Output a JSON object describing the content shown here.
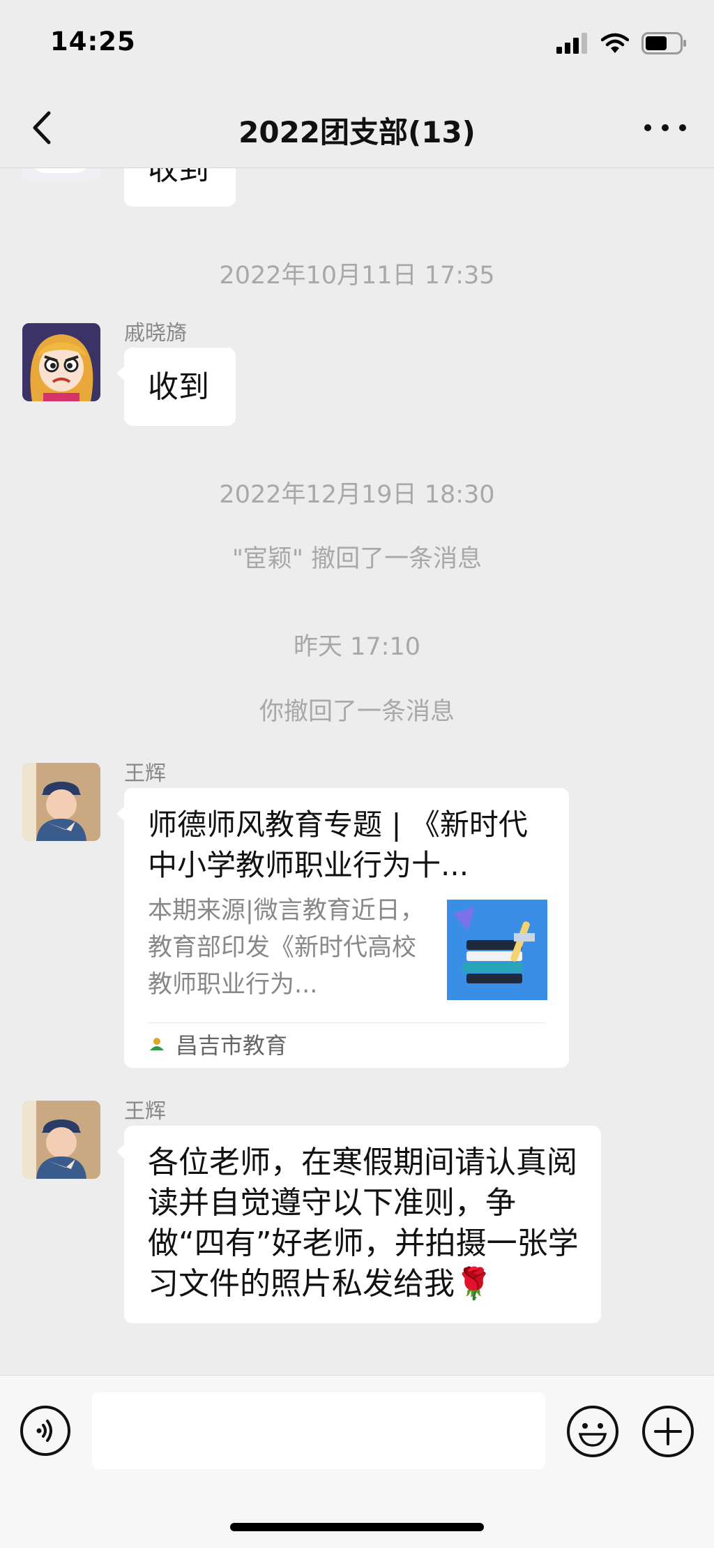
{
  "status_bar": {
    "time": "14:25"
  },
  "nav": {
    "title": "2022团支部(13)"
  },
  "messages": {
    "partial_bubble": "收到",
    "ts1": "2022年10月11日 17:35",
    "msg1": {
      "sender": "戚晓旖",
      "text": "收到"
    },
    "ts2": "2022年12月19日 18:30",
    "sys1": "\"宦颖\" 撤回了一条消息",
    "ts3": "昨天 17:10",
    "sys2": "你撤回了一条消息",
    "msg2": {
      "sender": "王辉",
      "card_title": "师德师风教育专题 | 《新时代中小学教师职业行为十...",
      "card_desc": "本期来源|微言教育近日，教育部印发《新时代高校教师职业行为...",
      "card_source": "昌吉市教育"
    },
    "msg3": {
      "sender": "王辉",
      "text": "各位老师，在寒假期间请认真阅读并自觉遵守以下准则，争做“四有”好老师，并拍摄一张学习文件的照片私发给我🌹"
    }
  },
  "icons": [
    "back-arrow-icon",
    "more-icon",
    "signal-icon",
    "wifi-icon",
    "battery-icon",
    "voice-icon",
    "emoji-icon",
    "plus-icon"
  ],
  "colors": {
    "background": "#ededed",
    "bubble": "#ffffff",
    "meta_text": "#a8a8a8"
  }
}
